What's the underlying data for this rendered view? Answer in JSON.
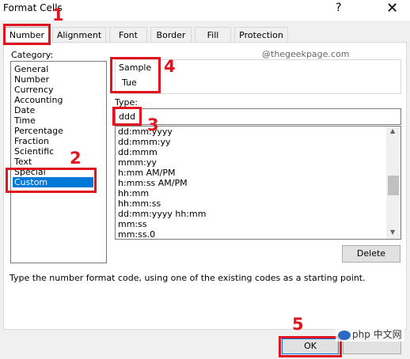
{
  "window": {
    "title": "Format Cells",
    "help_glyph": "?",
    "close_glyph": "✕"
  },
  "tabs": [
    "Number",
    "Alignment",
    "Font",
    "Border",
    "Fill",
    "Protection"
  ],
  "category": {
    "label": "Category:",
    "items": [
      "General",
      "Number",
      "Currency",
      "Accounting",
      "Date",
      "Time",
      "Percentage",
      "Fraction",
      "Scientific",
      "Text",
      "Special",
      "Custom"
    ],
    "selected": "Custom"
  },
  "sample": {
    "label": "Sample",
    "value": "Tue"
  },
  "type": {
    "label": "Type:",
    "value": "ddd",
    "formats": [
      "dd:mm:yyyy",
      "dd:mmm:yy",
      "dd:mmm",
      "mmm:yy",
      "h:mm AM/PM",
      "h:mm:ss AM/PM",
      "hh:mm",
      "hh:mm:ss",
      "dd:mm:yyyy hh:mm",
      "mm:ss",
      "mm:ss.0"
    ]
  },
  "buttons": {
    "delete": "Delete",
    "ok": "OK",
    "cancel": ""
  },
  "hint": "Type the number format code, using one of the existing codes as a starting point.",
  "watermark": "@thegeekpage.com",
  "annotations": {
    "n1": "1",
    "n2": "2",
    "n3": "3",
    "n4": "4",
    "n5": "5"
  },
  "logo": {
    "text": "php 中文网"
  },
  "icons": {
    "scroll_up": "up-arrow-icon",
    "scroll_down": "down-arrow-icon",
    "close": "close-icon"
  },
  "colors": {
    "selection": "#0078d7",
    "annotation": "#e0141e",
    "dialog_bg": "#f0f0f0"
  }
}
